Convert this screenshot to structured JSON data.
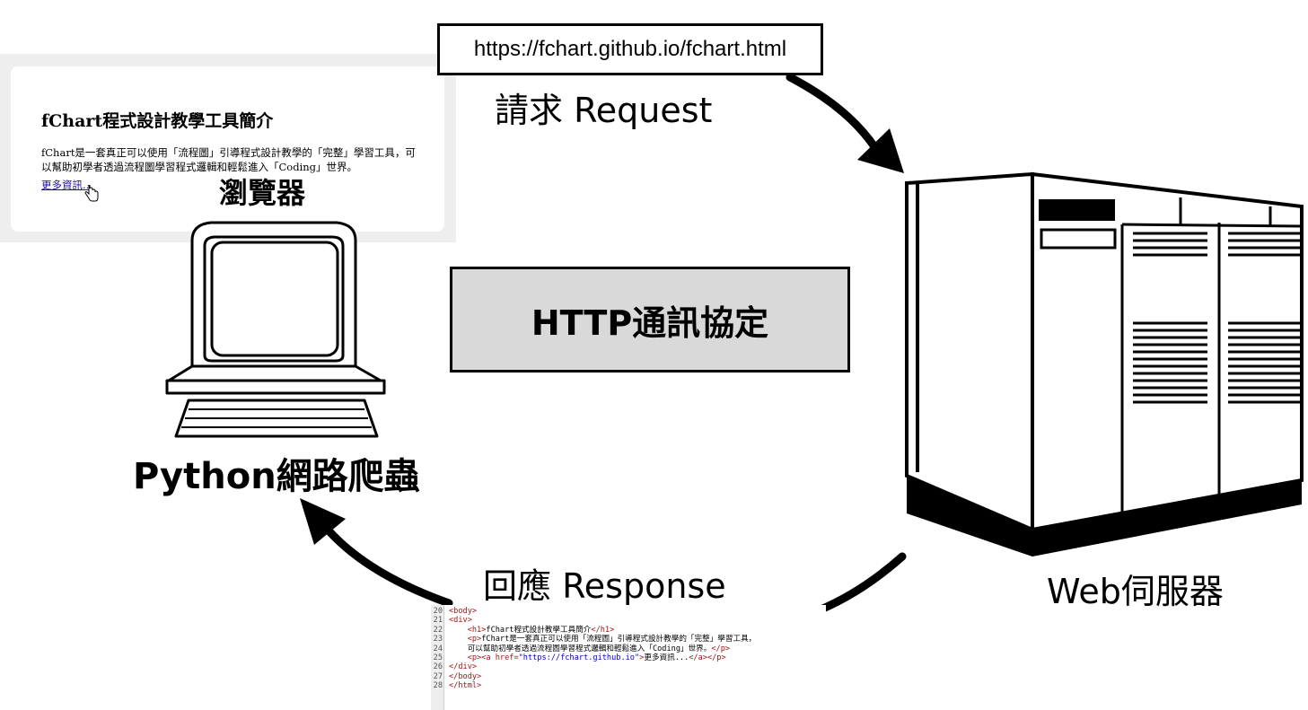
{
  "url": "https://fchart.github.io/fchart.html",
  "request_label": "請求 Request",
  "response_label": "回應 Response",
  "protocol_label": "HTTP通訊協定",
  "server_label": "Web伺服器",
  "crawler_label": "Python網路爬蟲",
  "browser": {
    "label": "瀏覽器",
    "page_title": "fChart程式設計教學工具簡介",
    "paragraph": "fChart是一套真正可以使用「流程圖」引導程式設計教學的「完整」學習工具，可以幫助初學者透過流程圖學習程式邏輯和輕鬆進入「Coding」世界。",
    "link_text": "更多資訊..."
  },
  "code": {
    "lines": [
      {
        "num": "20",
        "indent": "",
        "parts": [
          {
            "t": "<body>",
            "c": "tag"
          }
        ]
      },
      {
        "num": "21",
        "indent": "",
        "parts": [
          {
            "t": "<div>",
            "c": "tag"
          }
        ]
      },
      {
        "num": "22",
        "indent": "    ",
        "parts": [
          {
            "t": "<h1>",
            "c": "tag"
          },
          {
            "t": "fChart程式設計教學工具簡介",
            "c": ""
          },
          {
            "t": "</h1>",
            "c": "tag"
          }
        ]
      },
      {
        "num": "23",
        "indent": "    ",
        "parts": [
          {
            "t": "<p>",
            "c": "tag"
          },
          {
            "t": "fChart是一套真正可以使用「流程圖」引導程式設計教學的「完整」學習工具，",
            "c": ""
          }
        ]
      },
      {
        "num": "24",
        "indent": "    ",
        "parts": [
          {
            "t": "可以幫助初學者透過流程圖學習程式邏輯和輕鬆進入「Coding」世界。",
            "c": ""
          },
          {
            "t": "</p>",
            "c": "tag"
          }
        ]
      },
      {
        "num": "25",
        "indent": "    ",
        "parts": [
          {
            "t": "<p><a href=",
            "c": "tag"
          },
          {
            "t": "\"https://fchart.github.io\"",
            "c": "str"
          },
          {
            "t": ">",
            "c": "tag"
          },
          {
            "t": "更多資訊...",
            "c": ""
          },
          {
            "t": "</a></p>",
            "c": "tag"
          }
        ]
      },
      {
        "num": "26",
        "indent": "",
        "parts": [
          {
            "t": "</div>",
            "c": "tag"
          }
        ]
      },
      {
        "num": "27",
        "indent": "",
        "parts": [
          {
            "t": "</body>",
            "c": "tag"
          }
        ]
      },
      {
        "num": "28",
        "indent": "",
        "parts": [
          {
            "t": "</html>",
            "c": "tag"
          }
        ]
      }
    ]
  },
  "icons": [
    "computer-icon",
    "server-icon",
    "request-arrow-icon",
    "response-arrow-icon",
    "cursor-hand-icon"
  ]
}
